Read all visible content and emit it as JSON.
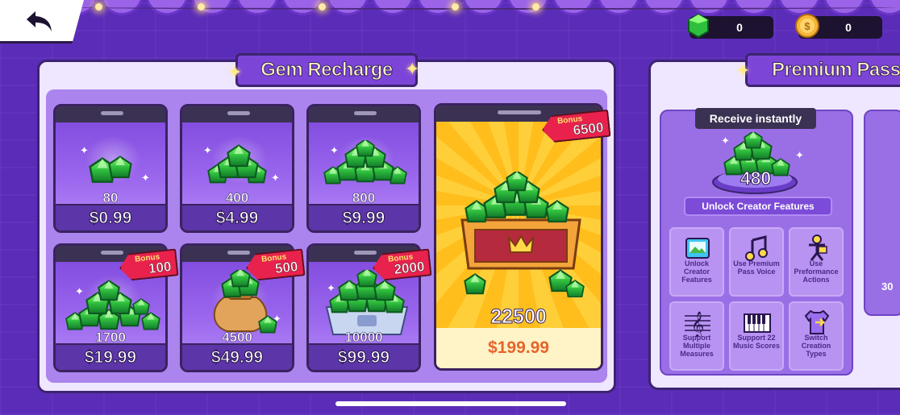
{
  "topbar": {
    "back_icon": "back-arrow-icon",
    "gems": {
      "icon": "gem-icon",
      "value": "0"
    },
    "coins": {
      "icon": "coin-icon",
      "value": "0"
    }
  },
  "gem_recharge": {
    "title": "Gem Recharge",
    "packs": [
      {
        "amount": "80",
        "price": "$0.99",
        "bonus": ""
      },
      {
        "amount": "400",
        "price": "$4.99",
        "bonus": ""
      },
      {
        "amount": "800",
        "price": "$9.99",
        "bonus": ""
      },
      {
        "amount": "1700",
        "price": "$19.99",
        "bonus": "100"
      },
      {
        "amount": "4500",
        "price": "$49.99",
        "bonus": "500"
      },
      {
        "amount": "10000",
        "price": "$99.99",
        "bonus": "2000"
      }
    ],
    "featured": {
      "amount": "22500",
      "price": "$199.99",
      "bonus": "6500"
    },
    "bonus_label": "Bonus"
  },
  "premium_pass": {
    "title": "Premium Pass",
    "receive_label": "Receive instantly",
    "gem_amount": "480",
    "unlock_banner": "Unlock Creator Features",
    "features": [
      {
        "icon": "image-icon",
        "label": "Unlock Creator Features"
      },
      {
        "icon": "music-note-icon",
        "label": "Use Premium Pass Voice"
      },
      {
        "icon": "performer-icon",
        "label": "Use Preformance Actions"
      },
      {
        "icon": "treble-clef-icon",
        "label": "Support Multiple Measures"
      },
      {
        "icon": "piano-icon",
        "label": "Support 22 Music Scores"
      },
      {
        "icon": "shirt-icon",
        "label": "Switch Creation Types"
      }
    ],
    "side_peek": "30"
  },
  "colors": {
    "background": "#5b2cb8",
    "panel": "#efe6ff",
    "accent": "#7c45d8",
    "bonus_tag": "#e8224d",
    "gem": "#2bb34a",
    "featured_bg": "#ffcf3a"
  }
}
